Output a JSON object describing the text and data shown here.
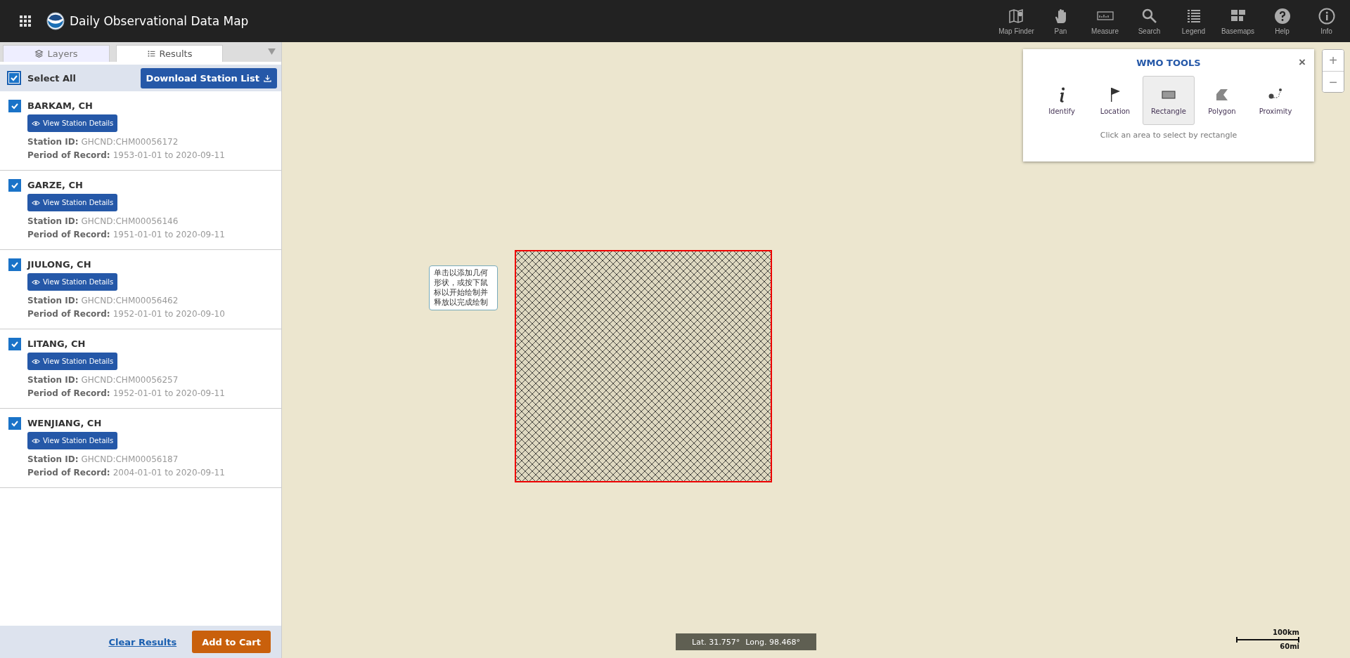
{
  "app": {
    "title": "Daily Observational Data Map"
  },
  "toolbar": [
    {
      "label": "Map Finder",
      "kind": "map"
    },
    {
      "label": "Pan",
      "kind": "hand"
    },
    {
      "label": "Measure",
      "kind": "ruler"
    },
    {
      "label": "Search",
      "kind": "search"
    },
    {
      "label": "Legend",
      "kind": "list"
    },
    {
      "label": "Basemaps",
      "kind": "grid"
    },
    {
      "label": "Help",
      "kind": "help"
    },
    {
      "label": "Info",
      "kind": "info"
    }
  ],
  "tabs": [
    {
      "label": "Layers",
      "kind": "layers",
      "selected": false
    },
    {
      "label": "Results",
      "kind": "list",
      "selected": true
    }
  ],
  "results": {
    "select_all": {
      "label": "Select All",
      "checked": true
    },
    "download_button": "Download Station List",
    "stations": [
      {
        "name": "BARKAM, CH",
        "checked": true,
        "details_button": "View Station Details",
        "id_label": "Station ID:",
        "id": "GHCND:CHM00056172",
        "period_label": "Period of Record:",
        "period": "1953-01-01 to 2020-09-11"
      },
      {
        "name": "GARZE, CH",
        "checked": true,
        "details_button": "View Station Details",
        "id_label": "Station ID:",
        "id": "GHCND:CHM00056146",
        "period_label": "Period of Record:",
        "period": "1951-01-01 to 2020-09-11"
      },
      {
        "name": "JIULONG, CH",
        "checked": true,
        "details_button": "View Station Details",
        "id_label": "Station ID:",
        "id": "GHCND:CHM00056462",
        "period_label": "Period of Record:",
        "period": "1952-01-01 to 2020-09-10"
      },
      {
        "name": "LITANG, CH",
        "checked": true,
        "details_button": "View Station Details",
        "id_label": "Station ID:",
        "id": "GHCND:CHM00056257",
        "period_label": "Period of Record:",
        "period": "1952-01-01 to 2020-09-11"
      },
      {
        "name": "WENJIANG, CH",
        "checked": true,
        "details_button": "View Station Details",
        "id_label": "Station ID:",
        "id": "GHCND:CHM00056187",
        "period_label": "Period of Record:",
        "period": "2004-01-01 to 2020-09-11"
      }
    ],
    "clear_link": "Clear Results",
    "add_button": "Add to Cart"
  },
  "map": {
    "tooltip": "单击以添加几何形状，或按下鼠标以开始绘制并释放以完成绘制",
    "zoom_in": "+",
    "zoom_out": "−",
    "coordinates": {
      "lat": "Lat. 31.757°",
      "long": "Long. 98.468°"
    },
    "scale": {
      "km": "100km",
      "mi": "60mi"
    },
    "wmo_tools": {
      "title": "WMO TOOLS",
      "close": "×",
      "hint": "Click an area to select by rectangle",
      "tools": [
        {
          "label": "Identify",
          "kind": "identify",
          "selected": false
        },
        {
          "label": "Location",
          "kind": "flag",
          "selected": false
        },
        {
          "label": "Rectangle",
          "kind": "rectangle",
          "selected": true
        },
        {
          "label": "Polygon",
          "kind": "polygon",
          "selected": false
        },
        {
          "label": "Proximity",
          "kind": "proximity",
          "selected": false
        }
      ]
    }
  }
}
